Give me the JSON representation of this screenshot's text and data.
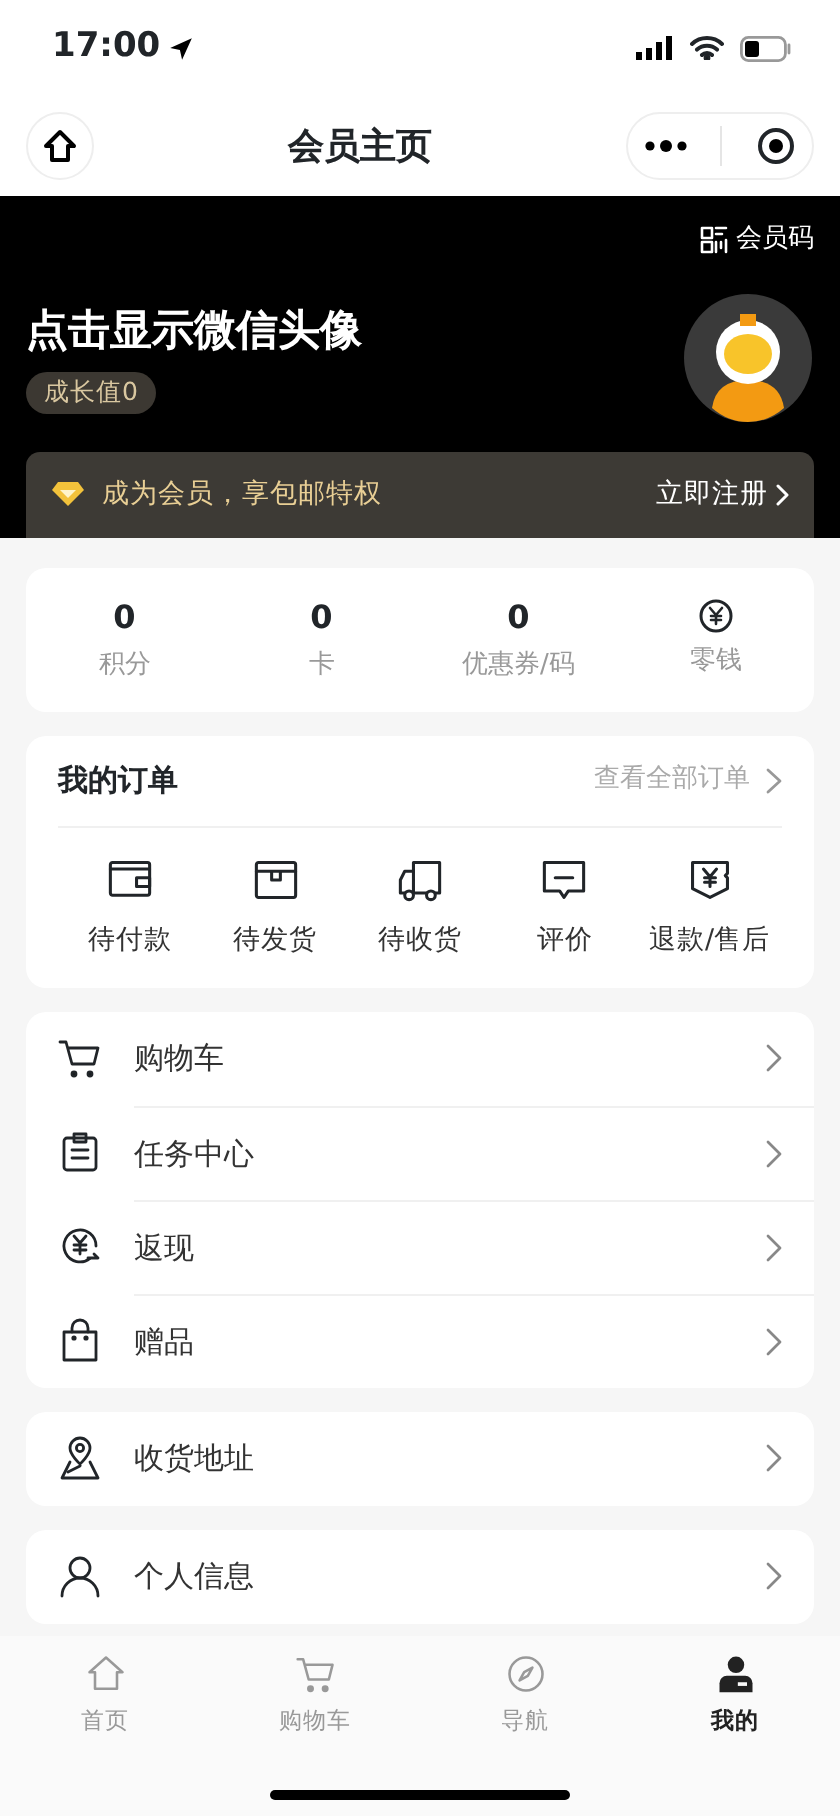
{
  "status_bar": {
    "time": "17:00"
  },
  "nav": {
    "title": "会员主页"
  },
  "header": {
    "member_code": "会员码",
    "name": "点击显示微信头像",
    "growth": "成长值0",
    "promo": {
      "text": "成为会员，享包邮特权",
      "action": "立即注册"
    }
  },
  "stats": [
    {
      "kind": "number",
      "value": "0",
      "label": "积分"
    },
    {
      "kind": "number",
      "value": "0",
      "label": "卡"
    },
    {
      "kind": "number",
      "value": "0",
      "label": "优惠券/码"
    },
    {
      "kind": "icon",
      "label": "零钱"
    }
  ],
  "orders": {
    "title": "我的订单",
    "view_all": "查看全部订单",
    "items": [
      "待付款",
      "待发货",
      "待收货",
      "评价",
      "退款/售后"
    ]
  },
  "menu_groups": [
    [
      "购物车",
      "任务中心",
      "返现",
      "赠品"
    ],
    [
      "收货地址"
    ],
    [
      "个人信息"
    ]
  ],
  "tab_bar": [
    {
      "label": "首页",
      "selected": false
    },
    {
      "label": "购物车",
      "selected": false
    },
    {
      "label": "导航",
      "selected": false
    },
    {
      "label": "我的",
      "selected": true
    }
  ]
}
